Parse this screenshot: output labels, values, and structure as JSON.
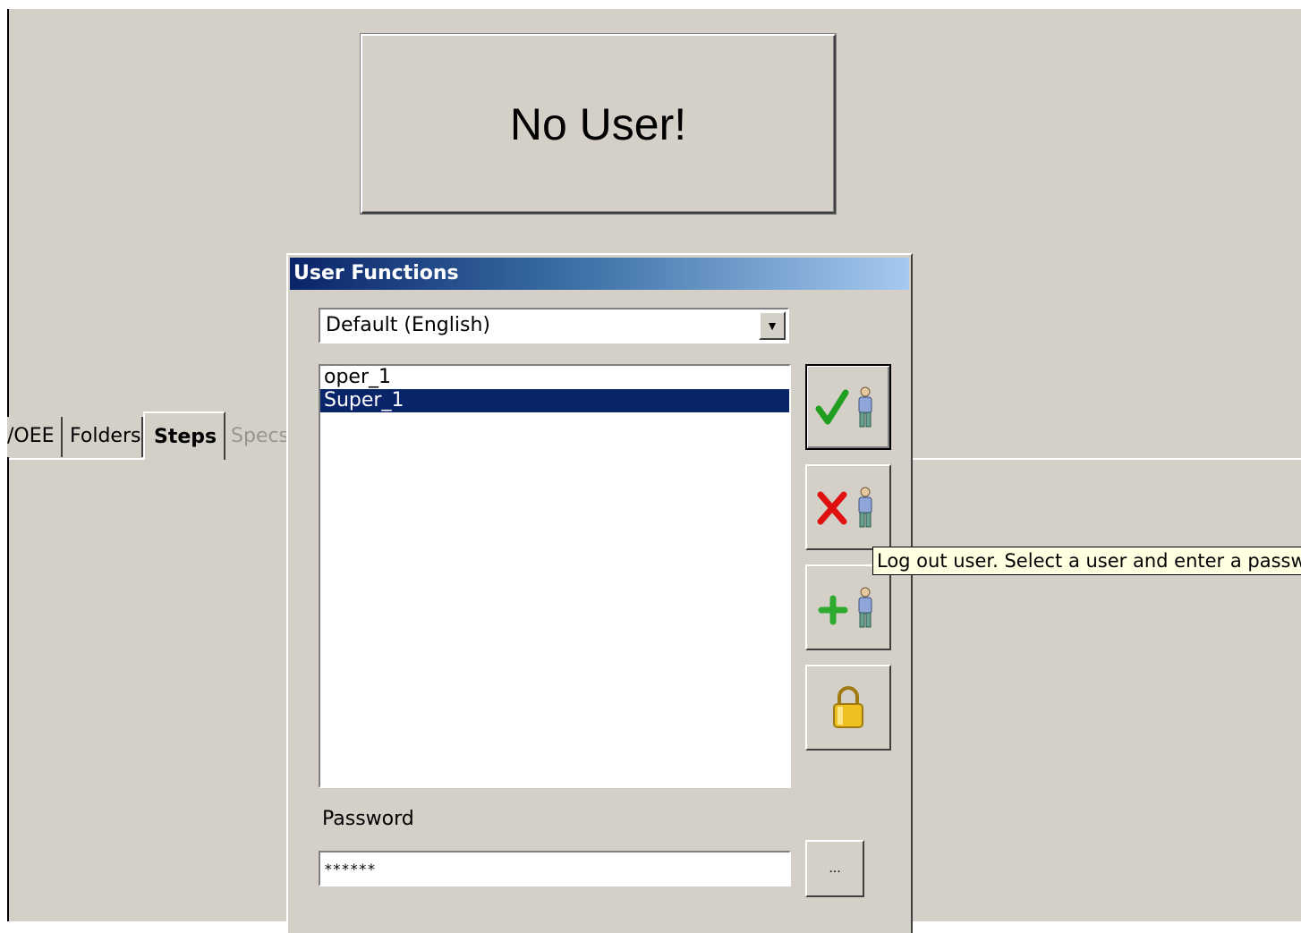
{
  "status": {
    "text": "No User!"
  },
  "tabs": [
    {
      "label": "/OEE",
      "state": "normal"
    },
    {
      "label": "Folders",
      "state": "normal"
    },
    {
      "label": "Steps",
      "state": "active"
    },
    {
      "label": "Specs",
      "state": "disabled"
    }
  ],
  "dialog": {
    "title": "User Functions",
    "language": {
      "selected": "Default (English)"
    },
    "users": [
      "oper_1",
      "Super_1"
    ],
    "selected_user": "Super_1",
    "buttons": [
      {
        "name": "login-user",
        "icons": [
          "check-icon",
          "user-icon"
        ]
      },
      {
        "name": "logout-user",
        "icons": [
          "x-icon",
          "user-icon"
        ]
      },
      {
        "name": "add-user",
        "icons": [
          "plus-icon",
          "user-icon"
        ]
      },
      {
        "name": "lock",
        "icons": [
          "lock-icon"
        ]
      }
    ],
    "password": {
      "label": "Password",
      "value": "******"
    },
    "browse_label": "..."
  },
  "tooltip": {
    "text": "Log out user. Select a user and enter a password"
  },
  "colors": {
    "background": "#d4d0c8",
    "title_start": "#0a246a",
    "title_end": "#a6caf0",
    "selection": "#0a246a",
    "check": "#1f9e1f",
    "cross": "#e01010",
    "plus": "#2eaa2e",
    "lock": "#f0c020"
  }
}
